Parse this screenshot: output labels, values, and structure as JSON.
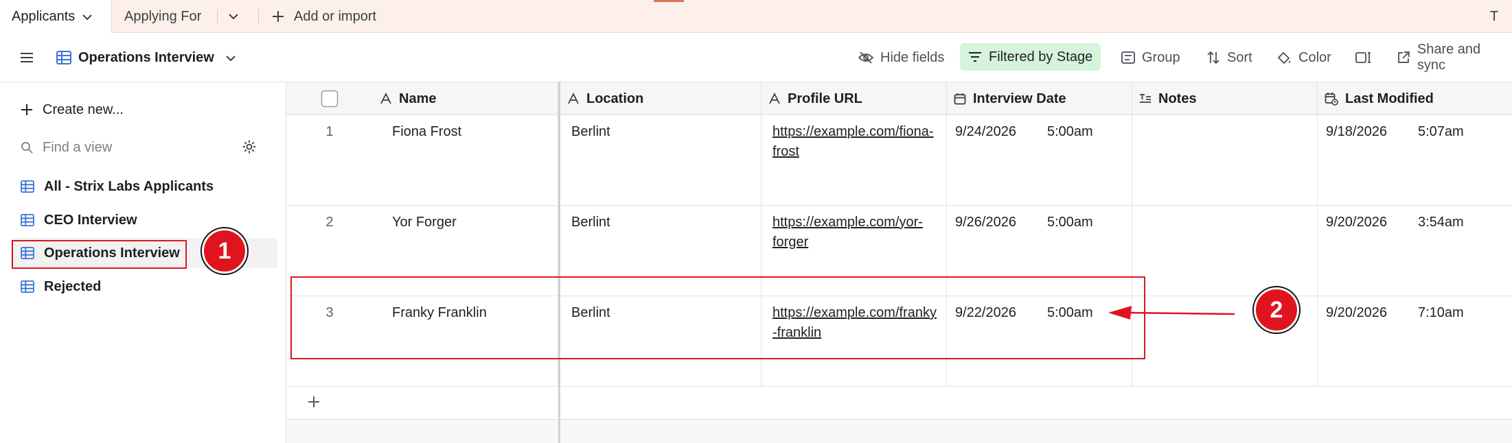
{
  "tabs": {
    "active": "Applicants",
    "second": "Applying For",
    "add": "Add or import",
    "right_partial": "T"
  },
  "toolbar": {
    "view_name": "Operations Interview",
    "hide_fields": "Hide fields",
    "filter": "Filtered by Stage",
    "group": "Group",
    "sort": "Sort",
    "color": "Color",
    "share": "Share and sync"
  },
  "sidebar": {
    "create": "Create new...",
    "find_placeholder": "Find a view",
    "views": [
      {
        "label": "All - Strix Labs Applicants"
      },
      {
        "label": "CEO Interview"
      },
      {
        "label": "Operations Interview"
      },
      {
        "label": "Rejected"
      }
    ]
  },
  "grid": {
    "columns": {
      "name": "Name",
      "location": "Location",
      "profile_url": "Profile URL",
      "interview_date": "Interview Date",
      "notes": "Notes",
      "last_modified": "Last Modified"
    },
    "rows": [
      {
        "num": "1",
        "name": "Fiona Frost",
        "location": "Berlint",
        "url1": "https://example.com/fiona-",
        "url2": "frost",
        "date": "9/24/2026",
        "time": "5:00am",
        "notes": "",
        "mod_date": "9/18/2026",
        "mod_time": "5:07am"
      },
      {
        "num": "2",
        "name": "Yor Forger",
        "location": "Berlint",
        "url1": "https://example.com/yor-",
        "url2": "forger",
        "date": "9/26/2026",
        "time": "5:00am",
        "notes": "",
        "mod_date": "9/20/2026",
        "mod_time": "3:54am"
      },
      {
        "num": "3",
        "name": "Franky Franklin",
        "location": "Berlint",
        "url1": "https://example.com/franky",
        "url2": "-franklin",
        "date": "9/22/2026",
        "time": "5:00am",
        "notes": "",
        "mod_date": "9/20/2026",
        "mod_time": "7:10am"
      }
    ]
  },
  "annotations": {
    "badge1": "1",
    "badge2": "2"
  },
  "colors": {
    "accent_red": "#e0141e",
    "filter_green": "#d6f3dc",
    "tabbar_bg": "#fdf0ea",
    "view_icon_blue": "#3a73d8"
  }
}
